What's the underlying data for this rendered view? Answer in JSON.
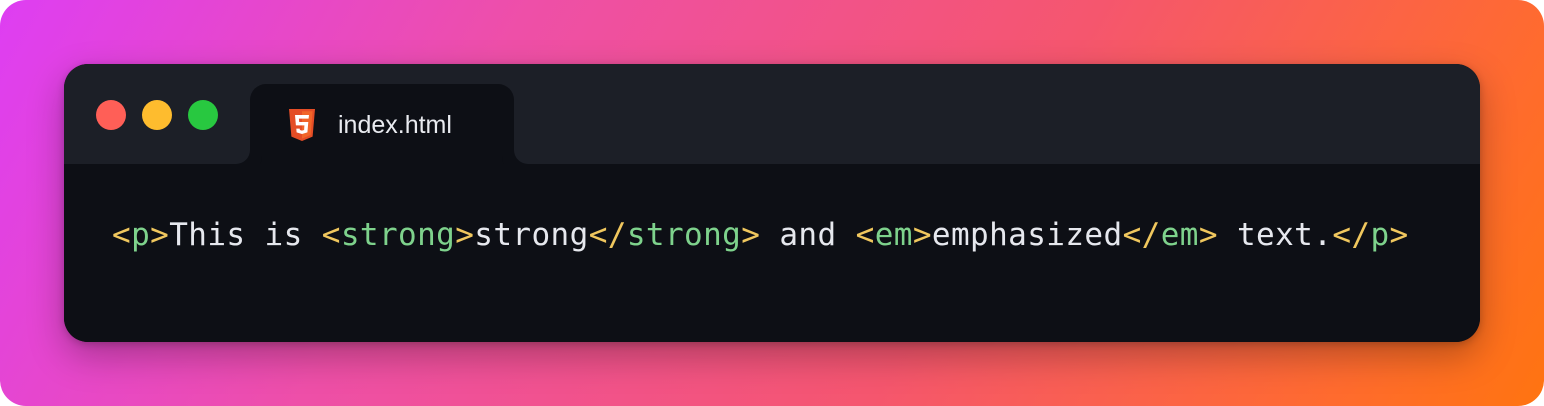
{
  "window": {
    "traffic_lights": [
      {
        "name": "close",
        "color": "#ff5f57"
      },
      {
        "name": "minimize",
        "color": "#febc2e"
      },
      {
        "name": "maximize",
        "color": "#28c840"
      }
    ],
    "tab": {
      "icon": "html5-icon",
      "icon_color": "#e44d26",
      "label": "index.html"
    }
  },
  "code": {
    "colors": {
      "bracket": "#f0c75e",
      "tag": "#7ed28c",
      "text": "#e6e8ee"
    },
    "tokens": [
      {
        "t": "<",
        "k": "bracket"
      },
      {
        "t": "p",
        "k": "tag"
      },
      {
        "t": ">",
        "k": "bracket"
      },
      {
        "t": "This is ",
        "k": "text"
      },
      {
        "t": "<",
        "k": "bracket"
      },
      {
        "t": "strong",
        "k": "tag"
      },
      {
        "t": ">",
        "k": "bracket"
      },
      {
        "t": "strong",
        "k": "text"
      },
      {
        "t": "</",
        "k": "bracket"
      },
      {
        "t": "strong",
        "k": "tag"
      },
      {
        "t": ">",
        "k": "bracket"
      },
      {
        "t": " and ",
        "k": "text"
      },
      {
        "t": "<",
        "k": "bracket"
      },
      {
        "t": "em",
        "k": "tag"
      },
      {
        "t": ">",
        "k": "bracket"
      },
      {
        "t": "emphasized",
        "k": "text"
      },
      {
        "t": "</",
        "k": "bracket"
      },
      {
        "t": "em",
        "k": "tag"
      },
      {
        "t": ">",
        "k": "bracket"
      },
      {
        "t": " text.",
        "k": "text"
      },
      {
        "t": "</",
        "k": "bracket"
      },
      {
        "t": "p",
        "k": "tag"
      },
      {
        "t": ">",
        "k": "bracket"
      }
    ]
  }
}
